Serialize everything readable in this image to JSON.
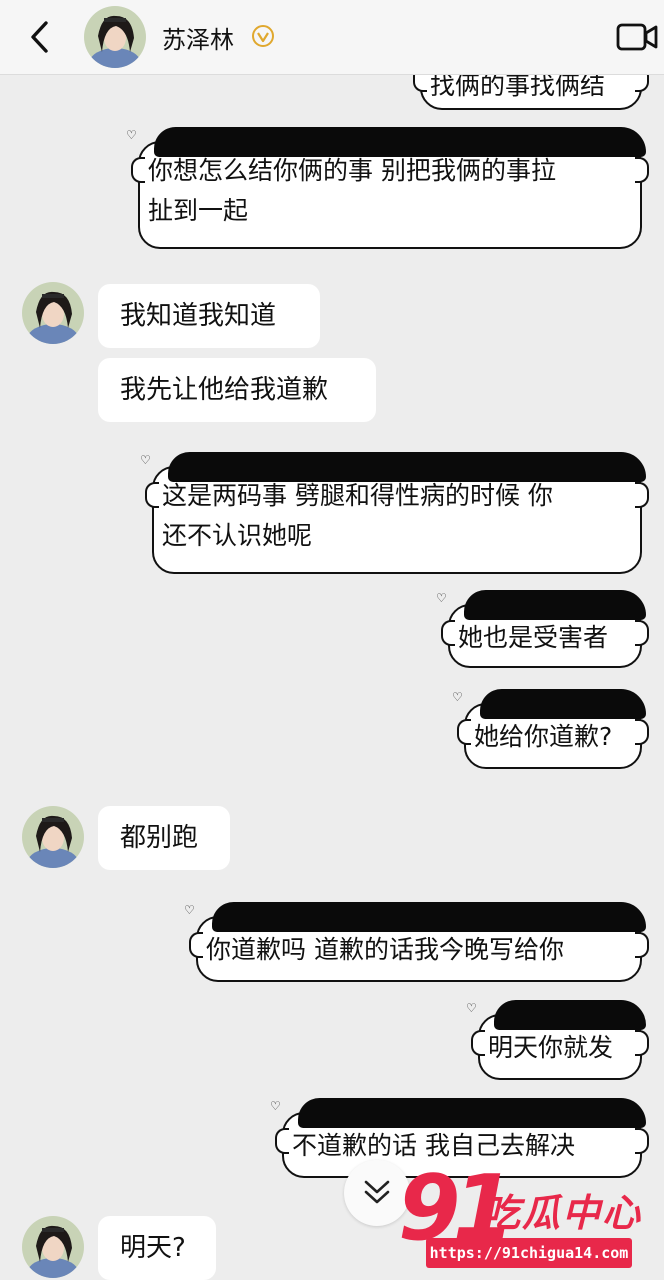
{
  "header": {
    "contact_name": "苏泽林"
  },
  "messages": {
    "m0": "找俩的事找俩结",
    "m1_l1": "你想怎么结你俩的事  别把我俩的事拉",
    "m1_l2": "扯到一起",
    "m2": "我知道我知道",
    "m3": "我先让他给我道歉",
    "m4_l1": "这是两码事  劈腿和得性病的时候  你",
    "m4_l2": "还不认识她呢",
    "m5": "她也是受害者",
    "m6": "她给你道歉?",
    "m7": "都别跑",
    "m8": "你道歉吗  道歉的话我今晚写给你",
    "m9": "明天你就发",
    "m10": "不道歉的话  我自己去解决",
    "m11": "明天?"
  },
  "watermark": {
    "number": "91",
    "title": "吃瓜中心",
    "url": "https://91chigua14.com"
  },
  "colors": {
    "background": "#ededed",
    "brand_red": "#e8284a",
    "verified_gold": "#e0a82e"
  }
}
